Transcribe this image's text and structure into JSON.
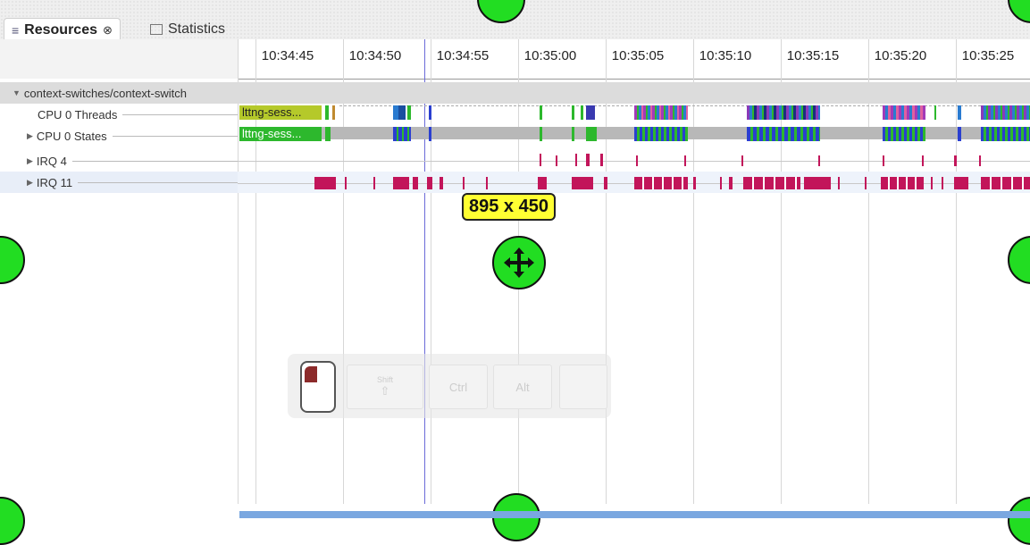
{
  "tabs": [
    {
      "label": "Resources",
      "close": "⊗",
      "icon": "resources-icon",
      "active": true
    },
    {
      "label": "Statistics",
      "icon": "statistics-icon",
      "active": false
    }
  ],
  "time_ticks": [
    "10:34:45",
    "10:34:50",
    "10:34:55",
    "10:35:00",
    "10:35:05",
    "10:35:10",
    "10:35:15",
    "10:35:20",
    "10:35:25"
  ],
  "tree": {
    "root": "context-switches/context-switch",
    "rows": [
      {
        "label": "CPU 0 Threads",
        "expander": ""
      },
      {
        "label": "CPU 0 States",
        "expander": "▶"
      },
      {
        "label": "IRQ 4",
        "expander": "▶"
      },
      {
        "label": "IRQ 11",
        "expander": "▶"
      }
    ],
    "root_expander": "▼"
  },
  "chips": {
    "threads": "lttng-sess...",
    "states": "lttng-sess..."
  },
  "size_badge": "895 x 450",
  "keys": {
    "shift": "Shift",
    "shift_symbol": "⇧",
    "ctrl": "Ctrl",
    "alt": "Alt",
    "extra": ""
  },
  "colors": {
    "thread_green": "#2db82d",
    "irq_magenta": "#c2155a",
    "handle_green": "#22dd22",
    "badge_yellow": "#ffff33"
  }
}
